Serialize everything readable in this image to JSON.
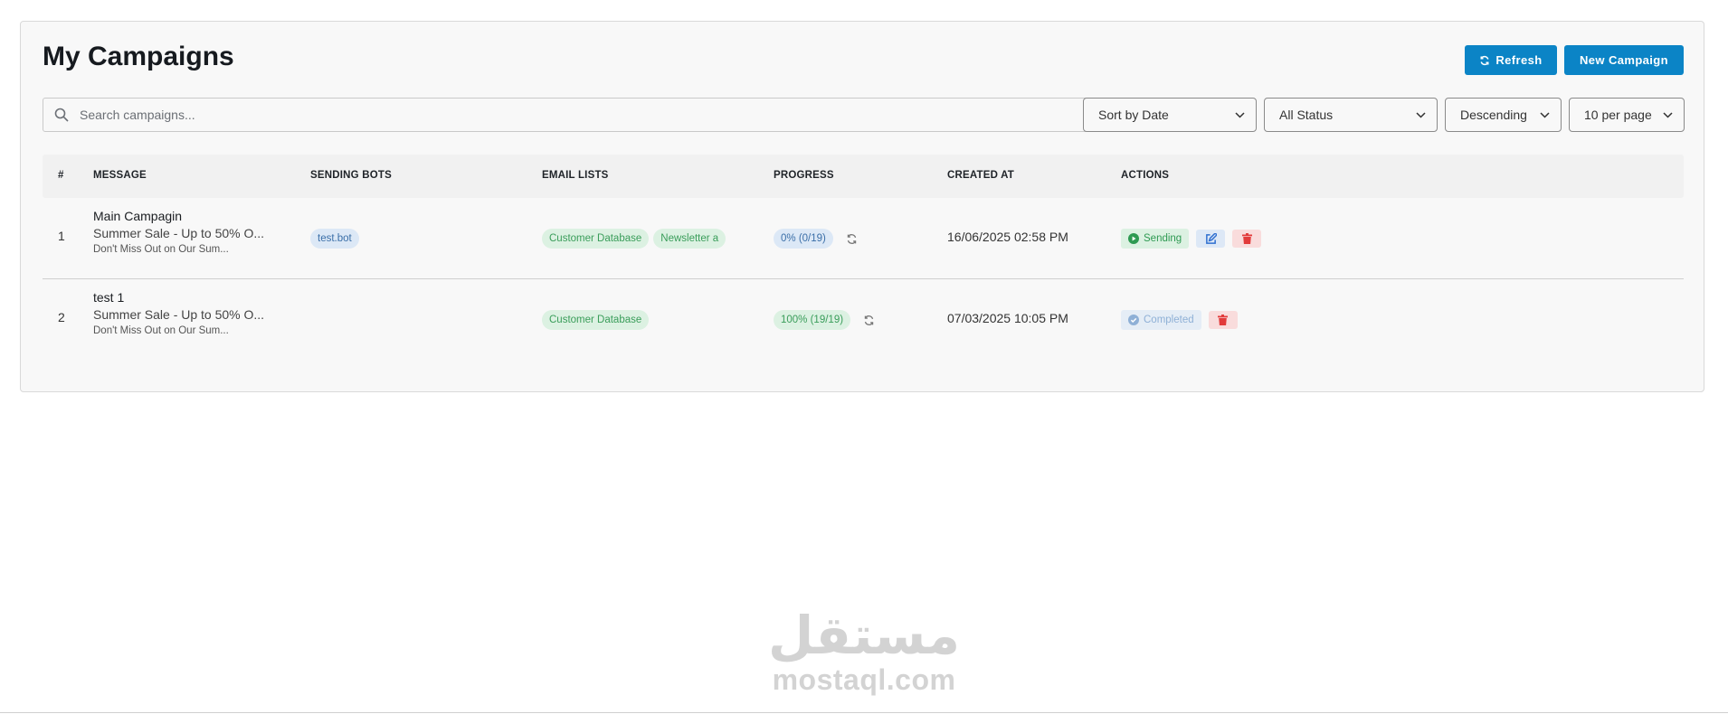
{
  "page": {
    "title": "My Campaigns",
    "refresh_label": "Refresh",
    "new_campaign_label": "New Campaign",
    "search_placeholder": "Search campaigns...",
    "accent_color": "#0b84c6"
  },
  "filters": {
    "sort": "Sort by Date",
    "status": "All Status",
    "order": "Descending",
    "per_page": "10 per page"
  },
  "table": {
    "headers": {
      "index": "#",
      "message": "MESSAGE",
      "bots": "SENDING BOTS",
      "lists": "EMAIL LISTS",
      "progress": "PROGRESS",
      "created": "CREATED AT",
      "actions": "ACTIONS"
    },
    "rows": [
      {
        "index": "1",
        "title": "Main Campagin",
        "subject": "Summer Sale - Up to 50% O...",
        "preview": "Don't Miss Out on Our Sum...",
        "bots": [
          "test.bot"
        ],
        "lists": [
          "Customer Database",
          "Newsletter a"
        ],
        "progress": "0% (0/19)",
        "created": "16/06/2025 02:58 PM",
        "status": "Sending"
      },
      {
        "index": "2",
        "title": "test 1",
        "subject": "Summer Sale - Up to 50% O...",
        "preview": "Don't Miss Out on Our Sum...",
        "bots": [],
        "lists": [
          "Customer Database"
        ],
        "progress": "100% (19/19)",
        "created": "07/03/2025 10:05 PM",
        "status": "Completed"
      }
    ]
  },
  "watermark": {
    "arabic": "مستقل",
    "latin": "mostaql.com"
  }
}
